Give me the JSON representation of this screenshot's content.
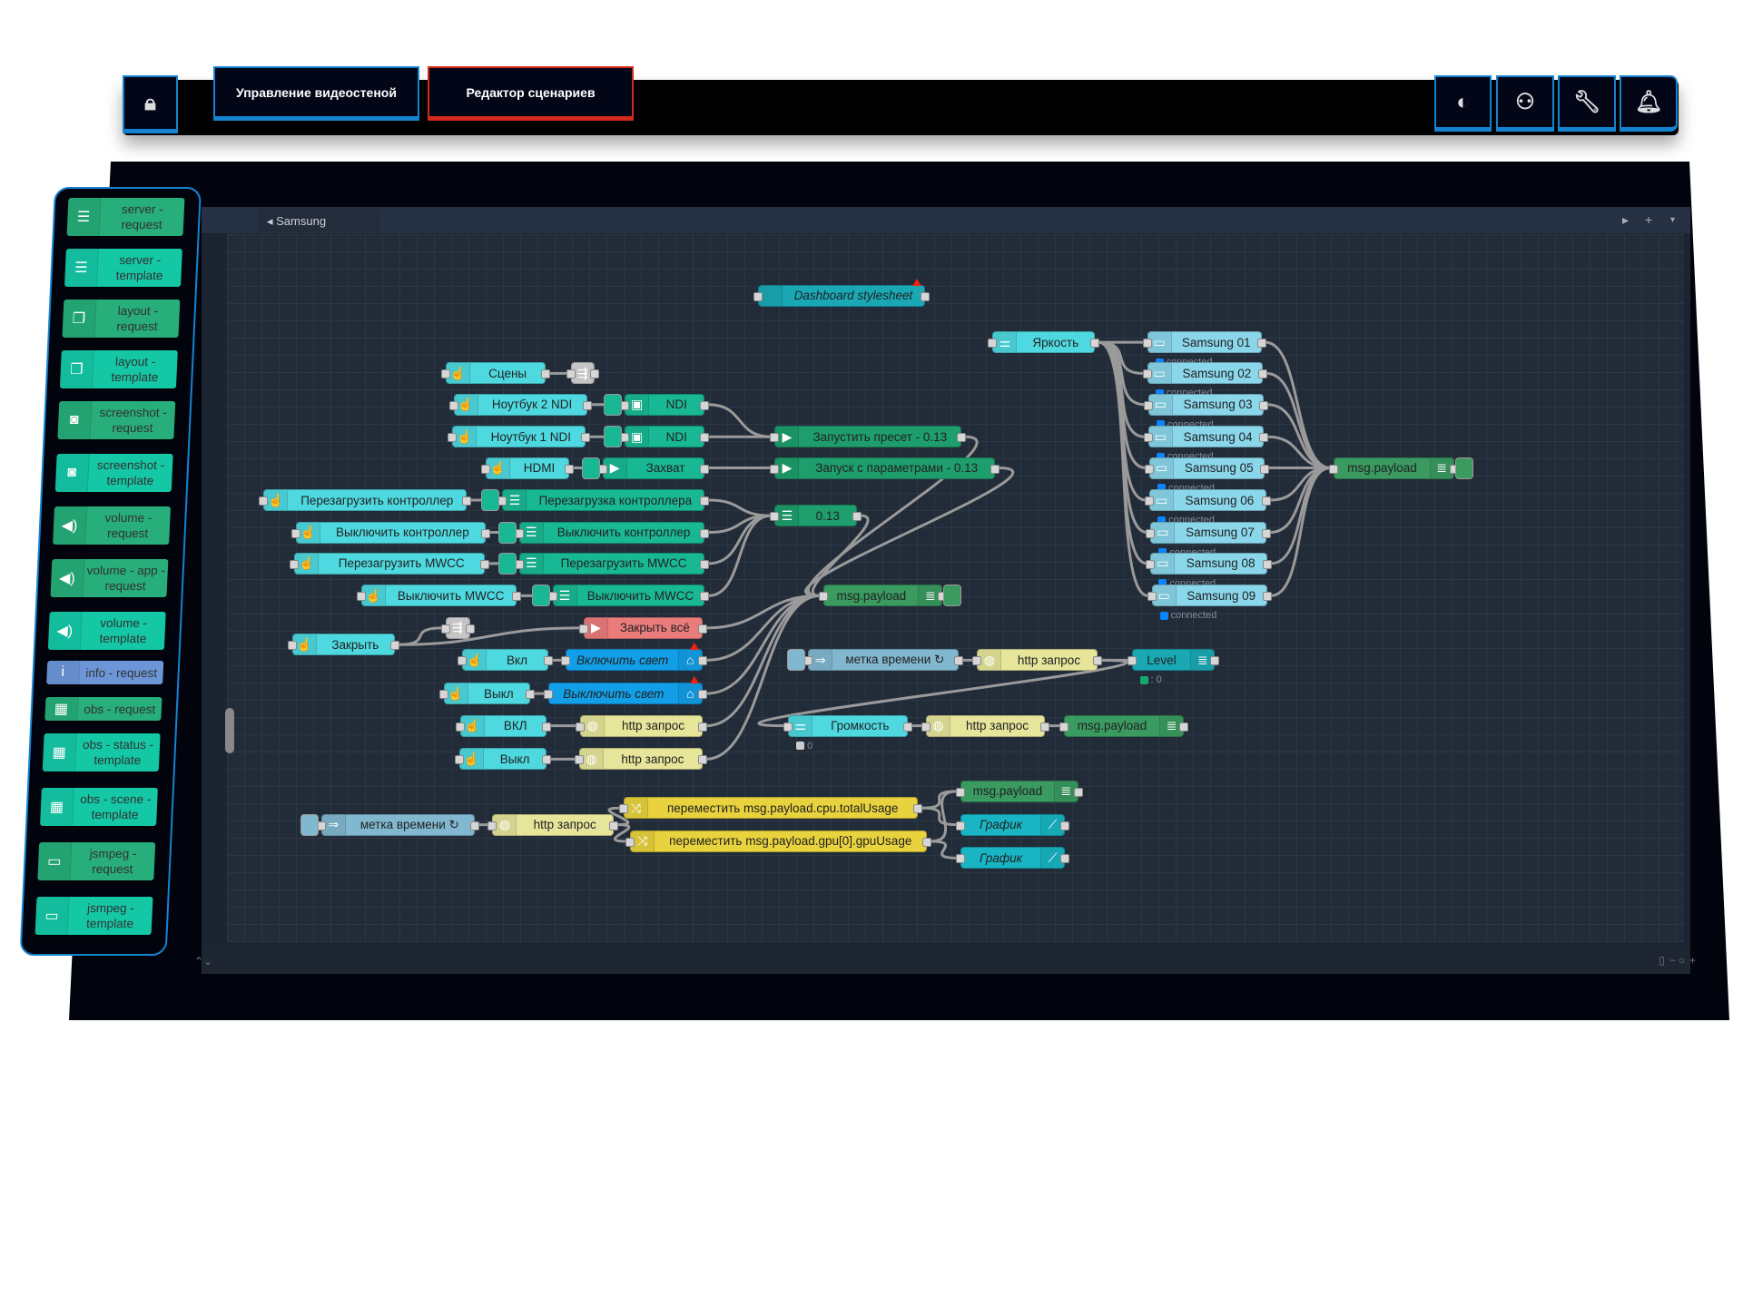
{
  "header": {
    "lock_icon": "lock-icon",
    "tabs": [
      {
        "label": "Управление видеостеной",
        "accent": "#1583d1"
      },
      {
        "label": "Редактор сценариев",
        "accent": "#d42a1c"
      }
    ],
    "actions": [
      {
        "icon": "contrast-icon"
      },
      {
        "icon": "user-icon"
      },
      {
        "icon": "wrench-icon"
      },
      {
        "icon": "bell-icon"
      }
    ]
  },
  "editor": {
    "flow_tab": "Samsung"
  },
  "palette": [
    {
      "label": "server - request",
      "icon": "server",
      "kind": "req"
    },
    {
      "label": "server - template",
      "icon": "server",
      "kind": "tpl"
    },
    {
      "label": "layout - request",
      "icon": "layout",
      "kind": "req"
    },
    {
      "label": "layout - template",
      "icon": "layout",
      "kind": "tpl"
    },
    {
      "label": "screenshot - request",
      "icon": "camera",
      "kind": "req"
    },
    {
      "label": "screenshot - template",
      "icon": "camera",
      "kind": "tpl"
    },
    {
      "label": "volume - request",
      "icon": "speaker",
      "kind": "req"
    },
    {
      "label": "volume - app - request",
      "icon": "speaker",
      "kind": "req"
    },
    {
      "label": "volume - template",
      "icon": "speaker",
      "kind": "tpl"
    },
    {
      "label": "info - request",
      "icon": "info",
      "kind": "info"
    },
    {
      "label": "obs - request",
      "icon": "grid",
      "kind": "req"
    },
    {
      "label": "obs - status - template",
      "icon": "grid",
      "kind": "tpl"
    },
    {
      "label": "obs - scene - template",
      "icon": "grid",
      "kind": "tpl"
    },
    {
      "label": "jsmpeg - request",
      "icon": "monitor",
      "kind": "req"
    },
    {
      "label": "jsmpeg - template",
      "icon": "monitor",
      "kind": "tpl"
    }
  ],
  "nodes": [
    {
      "label": "Dashboard stylesheet",
      "type": "css",
      "icon": "code",
      "italic": true,
      "warning": true
    },
    {
      "label": "Яркость",
      "type": "btn",
      "icon": "sliders"
    },
    {
      "label": "Samsung 01",
      "type": "sam",
      "icon": "monitor",
      "status": "connected",
      "status_color": "#0a84ff"
    },
    {
      "label": "Samsung 02",
      "type": "sam",
      "icon": "monitor",
      "status": "connected",
      "status_color": "#0a84ff"
    },
    {
      "label": "Samsung 03",
      "type": "sam",
      "icon": "monitor",
      "status": "connected",
      "status_color": "#0a84ff"
    },
    {
      "label": "Samsung 04",
      "type": "sam",
      "icon": "monitor",
      "status": "connected",
      "status_color": "#0a84ff"
    },
    {
      "label": "Samsung 05",
      "type": "sam",
      "icon": "monitor",
      "status": "connected",
      "status_color": "#0a84ff"
    },
    {
      "label": "Samsung 06",
      "type": "sam",
      "icon": "monitor",
      "status": "connected",
      "status_color": "#0a84ff"
    },
    {
      "label": "Samsung 07",
      "type": "sam",
      "icon": "monitor",
      "status": "connected",
      "status_color": "#0a84ff"
    },
    {
      "label": "Samsung 08",
      "type": "sam",
      "icon": "monitor",
      "status": "connected",
      "status_color": "#0a84ff"
    },
    {
      "label": "Samsung 09",
      "type": "sam",
      "icon": "monitor",
      "status": "connected",
      "status_color": "#0a84ff"
    },
    {
      "label": "msg.payload",
      "type": "dbg",
      "icon": "debug",
      "toggle": true
    },
    {
      "label": "Сцены",
      "type": "btn",
      "icon": "hand"
    },
    {
      "label": "",
      "type": "link",
      "icon": "link"
    },
    {
      "label": "Ноутбук 2 NDI",
      "type": "btn",
      "icon": "hand"
    },
    {
      "label": "NDI",
      "type": "ndi",
      "icon": "save",
      "button": true
    },
    {
      "label": "Ноутбук 1 NDI",
      "type": "btn",
      "icon": "hand"
    },
    {
      "label": "NDI",
      "type": "ndi",
      "icon": "save",
      "button": true
    },
    {
      "label": "HDMI",
      "type": "btn",
      "icon": "hand"
    },
    {
      "label": "Захват",
      "type": "ndi",
      "icon": "play",
      "button": true
    },
    {
      "label": "Перезагрузить контроллер",
      "type": "btn",
      "icon": "hand"
    },
    {
      "label": "Перезагрузка контроллера",
      "type": "ndi",
      "icon": "server",
      "button": true
    },
    {
      "label": "Выключить контроллер",
      "type": "btn",
      "icon": "hand"
    },
    {
      "label": "Выключить контроллер",
      "type": "ndi",
      "icon": "server",
      "button": true
    },
    {
      "label": "Перезагрузить MWCC",
      "type": "btn",
      "icon": "hand"
    },
    {
      "label": "Перезагрузить MWCC",
      "type": "ndi",
      "icon": "server",
      "button": true
    },
    {
      "label": "Выключить MWCC",
      "type": "btn",
      "icon": "hand"
    },
    {
      "label": "Выключить MWCC",
      "type": "ndi",
      "icon": "server",
      "button": true
    },
    {
      "label": "Запустить пресет - 0.13",
      "type": "green",
      "icon": "play"
    },
    {
      "label": "Запуск с параметрами - 0.13",
      "type": "green",
      "icon": "play"
    },
    {
      "label": "0.13",
      "type": "green",
      "icon": "server"
    },
    {
      "label": "msg.payload",
      "type": "dbg",
      "icon": "debug",
      "toggle": true
    },
    {
      "label": "Закрыть",
      "type": "btn",
      "icon": "hand"
    },
    {
      "label": "",
      "type": "link",
      "icon": "link"
    },
    {
      "label": "Закрыть всё",
      "type": "red",
      "icon": "play"
    },
    {
      "label": "Вкл",
      "type": "btn",
      "icon": "hand"
    },
    {
      "label": "Включить свет",
      "type": "blue",
      "icon": "router",
      "italic": true,
      "warning": true
    },
    {
      "label": "Выкл",
      "type": "btn",
      "icon": "hand"
    },
    {
      "label": "Выключить свет",
      "type": "blue",
      "icon": "router",
      "italic": true,
      "warning": true
    },
    {
      "label": "ВКЛ",
      "type": "btn",
      "icon": "hand"
    },
    {
      "label": "http запрос",
      "type": "http",
      "icon": "globe"
    },
    {
      "label": "Выкл",
      "type": "btn",
      "icon": "hand"
    },
    {
      "label": "http запрос",
      "type": "http",
      "icon": "globe"
    },
    {
      "label": "метка времени ↻",
      "type": "inj",
      "icon": "inject",
      "button": true
    },
    {
      "label": "http запрос",
      "type": "http",
      "icon": "globe"
    },
    {
      "label": "Level",
      "type": "css",
      "icon": "gauge",
      "status": ": 0",
      "status_color": "#17a86f"
    },
    {
      "label": "Громкость",
      "type": "btn",
      "icon": "sliders",
      "status": "0",
      "status_color": "#cccccc"
    },
    {
      "label": "http запрос",
      "type": "http",
      "icon": "globe"
    },
    {
      "label": "msg.payload",
      "type": "dbg",
      "icon": "debug"
    },
    {
      "label": "метка времени ↻",
      "type": "inj",
      "icon": "inject",
      "button": true
    },
    {
      "label": "http запрос",
      "type": "http",
      "icon": "globe"
    },
    {
      "label": "переместить msg.payload.cpu.totalUsage",
      "type": "chg",
      "icon": "shuffle"
    },
    {
      "label": "переместить msg.payload.gpu[0].gpuUsage",
      "type": "chg",
      "icon": "shuffle"
    },
    {
      "label": "msg.payload",
      "type": "dbg",
      "icon": "debug"
    },
    {
      "label": "График",
      "type": "chart",
      "icon": "chart",
      "italic": true
    },
    {
      "label": "График",
      "type": "chart",
      "icon": "chart",
      "italic": true
    }
  ],
  "colors": {
    "accent_blue": "#1583d1",
    "accent_red": "#d42a1c",
    "canvas": "#222b38",
    "wire": "#9a9a9a"
  }
}
